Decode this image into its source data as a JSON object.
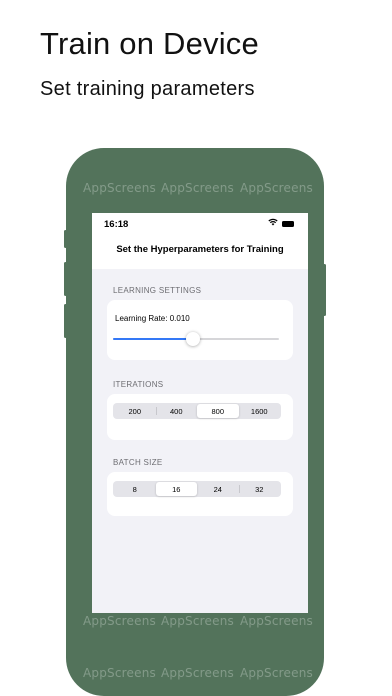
{
  "promo": {
    "title": "Train on Device",
    "subtitle": "Set training parameters"
  },
  "watermark": "AppScreens",
  "status_bar": {
    "time": "16:18"
  },
  "nav": {
    "title": "Set the Hyperparameters for Training"
  },
  "learning": {
    "header": "LEARNING SETTINGS",
    "label": "Learning Rate: 0.010",
    "slider_fraction": 0.48
  },
  "iterations": {
    "header": "ITERATIONS",
    "options": [
      "200",
      "400",
      "800",
      "1600"
    ],
    "selected": "800"
  },
  "batch": {
    "header": "BATCH SIZE",
    "options": [
      "8",
      "16",
      "24",
      "32"
    ],
    "selected": "16"
  },
  "colors": {
    "frame": "#53735b",
    "accent": "#3478f6",
    "grouped_background": "#f2f2f7"
  }
}
